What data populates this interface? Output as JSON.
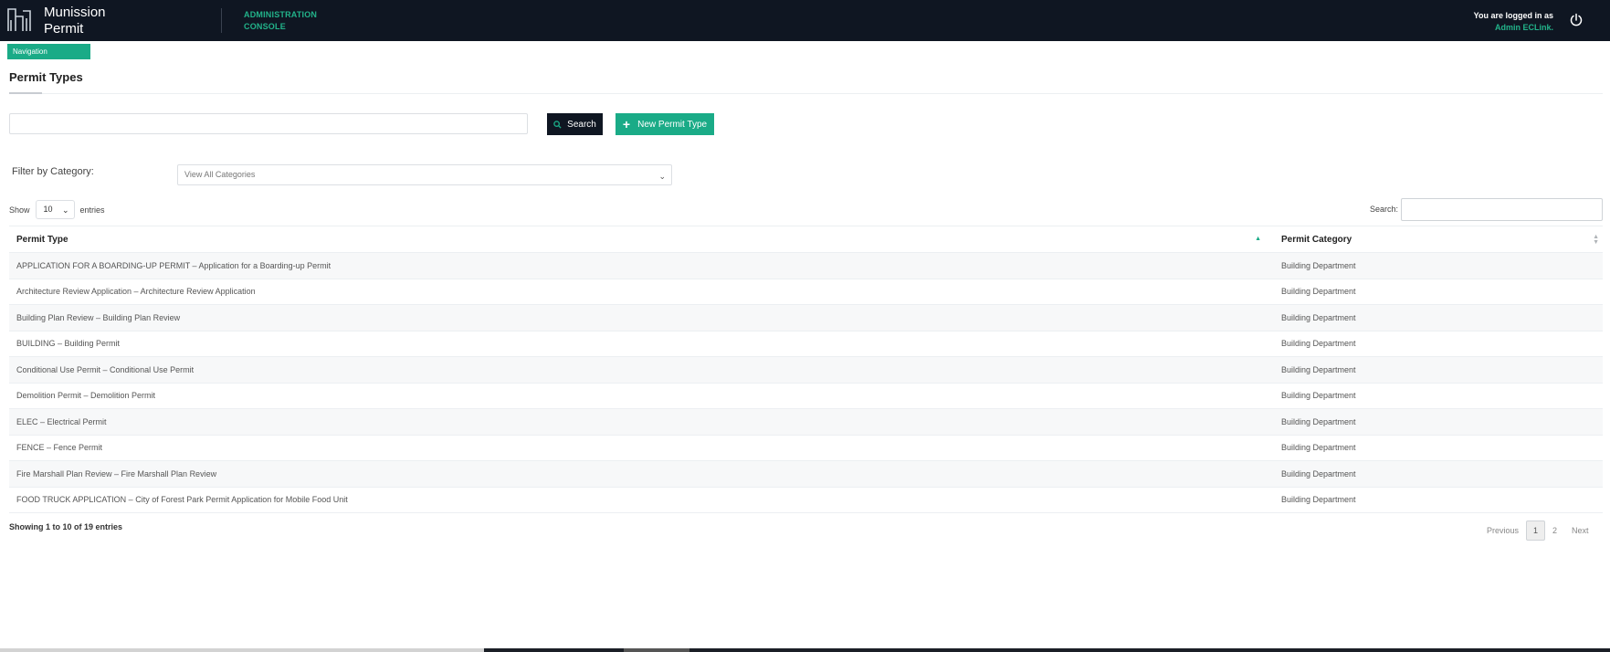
{
  "header": {
    "brand_line1": "Munission",
    "brand_line2": "Permit",
    "console_line1": "ADMINISTRATION",
    "console_line2": "CONSOLE",
    "login_label": "You are logged in as",
    "login_user": "Admin ECLink.",
    "icons": {
      "logo": "building-logo-icon",
      "power": "power-icon"
    }
  },
  "nav": {
    "label": "Navigation"
  },
  "page": {
    "title": "Permit Types"
  },
  "search": {
    "placeholder": "",
    "button_label": "Search",
    "new_button_label": "New Permit Type"
  },
  "filter": {
    "label": "Filter by Category:",
    "selected": "View All Categories"
  },
  "table_controls": {
    "show_label": "Show",
    "entries_value": "10",
    "entries_label": "entries",
    "search_label": "Search:"
  },
  "table": {
    "columns": [
      "Permit Type",
      "Permit Category"
    ],
    "rows": [
      [
        "APPLICATION FOR A BOARDING-UP PERMIT – Application for a Boarding-up Permit",
        "Building Department"
      ],
      [
        "Architecture Review Application – Architecture Review Application",
        "Building Department"
      ],
      [
        "Building Plan Review – Building Plan Review",
        "Building Department"
      ],
      [
        "BUILDING – Building Permit",
        "Building Department"
      ],
      [
        "Conditional Use Permit – Conditional Use Permit",
        "Building Department"
      ],
      [
        "Demolition Permit – Demolition Permit",
        "Building Department"
      ],
      [
        "ELEC – Electrical Permit",
        "Building Department"
      ],
      [
        "FENCE – Fence Permit",
        "Building Department"
      ],
      [
        "Fire Marshall Plan Review – Fire Marshall Plan Review",
        "Building Department"
      ],
      [
        "FOOD TRUCK APPLICATION – City of Forest Park Permit Application for Mobile Food Unit",
        "Building Department"
      ]
    ]
  },
  "footer": {
    "info": "Showing 1 to 10 of 19 entries",
    "pager": {
      "previous": "Previous",
      "pages": [
        "1",
        "2"
      ],
      "next": "Next"
    }
  },
  "colors": {
    "header_bg": "#0f1622",
    "accent": "#1aab87"
  }
}
